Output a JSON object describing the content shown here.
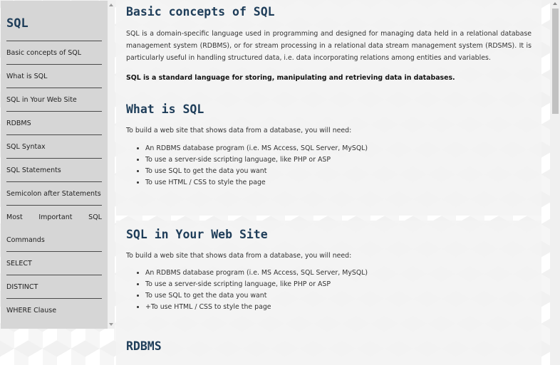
{
  "sidebar": {
    "title": "SQL",
    "items": [
      {
        "label": "Basic concepts of SQL"
      },
      {
        "label": "What is SQL"
      },
      {
        "label": "SQL in Your Web Site"
      },
      {
        "label": "RDBMS"
      },
      {
        "label": "SQL Syntax"
      },
      {
        "label": "SQL Statements"
      },
      {
        "label": "Semicolon after Statements"
      },
      {
        "label_parts": [
          "Most",
          "Important",
          "SQL"
        ]
      },
      {
        "label": "Commands"
      },
      {
        "label": "SELECT"
      },
      {
        "label": "DISTINCT"
      },
      {
        "label": "WHERE Clause"
      }
    ]
  },
  "sections": {
    "basic": {
      "title": "Basic concepts of SQL",
      "paragraph": "SQL is a domain-specific language used in programming and designed for managing data held in a relational database management system (RDBMS), or for stream processing in a relational data stream management system (RDSMS). It is particularly useful in handling structured data, i.e. data incorporating relations among entities and variables.",
      "bold": "SQL is a standard language for storing, manipulating and retrieving data in databases."
    },
    "what": {
      "title": "What is SQL",
      "intro": "To build a web site that shows data from a database, you will need:",
      "bullets": [
        "An RDBMS database program (i.e. MS Access, SQL Server, MySQL)",
        "To use a server-side scripting language, like PHP or ASP",
        "To use SQL to get the data you want",
        "To use HTML / CSS to style the page"
      ]
    },
    "website": {
      "title": "SQL in Your Web Site",
      "intro": "To build a web site that shows data from a database, you will need:",
      "bullets": [
        "An RDBMS database program (i.e. MS Access, SQL Server, MySQL)",
        "To use a server-side scripting language, like PHP or ASP",
        "To use SQL to get the data you want",
        "+To use HTML / CSS to style the page"
      ]
    },
    "rdbms": {
      "title": "RDBMS"
    }
  },
  "colors": {
    "heading": "#1e3d59",
    "sidebar_bg": "#d6d6d6",
    "card_bg": "#f3f3f3"
  }
}
